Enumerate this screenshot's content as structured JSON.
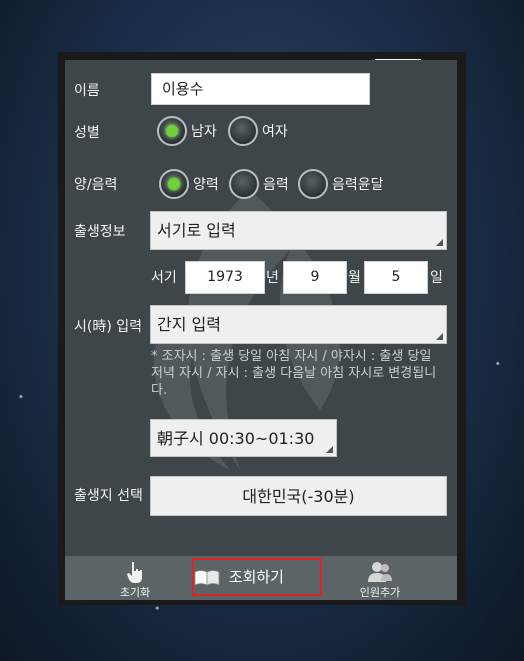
{
  "form": {
    "name_label": "이름",
    "name_value": "이용수",
    "gender_label": "성별",
    "gender_options": [
      "남자",
      "여자"
    ],
    "gender_selected": "남자",
    "calendar_label": "양/음력",
    "calendar_options": [
      "양력",
      "음력",
      "음력윤달"
    ],
    "calendar_selected": "양력",
    "birth_info_label": "출생정보",
    "birth_info_spinner": "서기로 입력",
    "era_label": "서기",
    "year_value": "1973",
    "year_unit": "년",
    "month_value": "9",
    "month_unit": "월",
    "day_value": "5",
    "day_unit": "일",
    "hour_label": "시(時) 입력",
    "hour_spinner": "간지 입력",
    "hour_note": "* 조자시 : 출생 당일 아침 자시 / 야자시 : 출생 당일 저녁 자시 / 자시 : 출생 다음날 아침 자시로 변경됩니다.",
    "hour_select": "朝子시 00:30~01:30",
    "birthplace_label": "출생지 선택",
    "birthplace_value": "대한민국(-30분)"
  },
  "bottom_bar": {
    "reset_label": "초기화",
    "search_label": "조회하기",
    "add_person_label": "인원추가"
  },
  "colors": {
    "panel": "#3f4649",
    "bottom_bar": "#5d6467",
    "radio_selected": "#6fd23a",
    "highlight_border": "#e02424"
  },
  "icons": [
    "hand-pointer-icon",
    "book-icon",
    "people-icon"
  ]
}
